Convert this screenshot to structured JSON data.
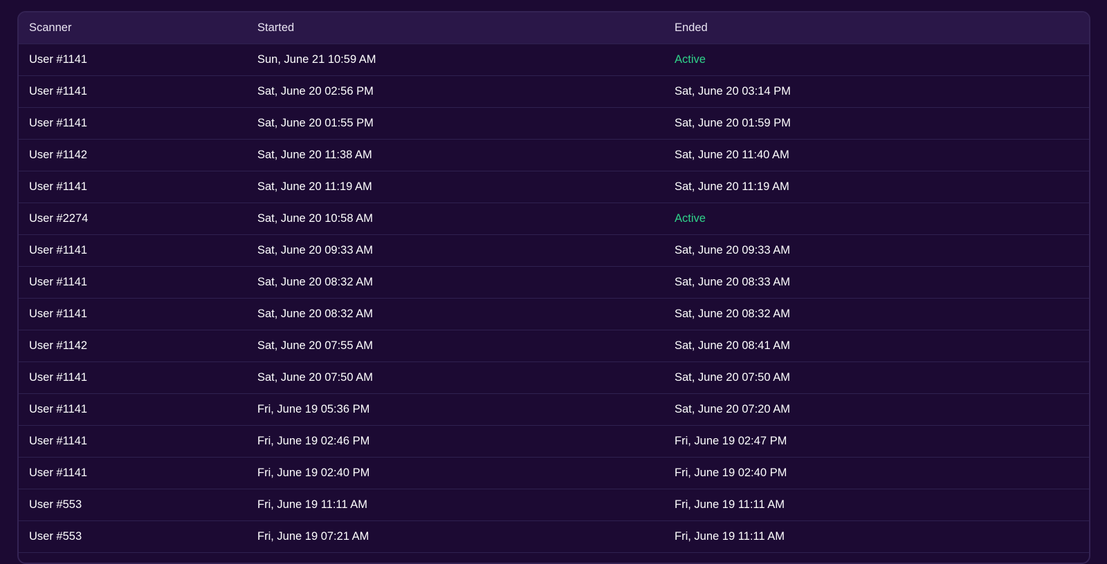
{
  "table": {
    "columns": [
      "Scanner",
      "Started",
      "Ended"
    ],
    "active_color": "#2fd38a",
    "rows": [
      {
        "scanner": "User #1141",
        "started": "Sun, June 21 10:59 AM",
        "ended": "Active",
        "active": true
      },
      {
        "scanner": "User #1141",
        "started": "Sat, June 20 02:56 PM",
        "ended": "Sat, June 20 03:14 PM",
        "active": false
      },
      {
        "scanner": "User #1141",
        "started": "Sat, June 20 01:55 PM",
        "ended": "Sat, June 20 01:59 PM",
        "active": false
      },
      {
        "scanner": "User #1142",
        "started": "Sat, June 20 11:38 AM",
        "ended": "Sat, June 20 11:40 AM",
        "active": false
      },
      {
        "scanner": "User #1141",
        "started": "Sat, June 20 11:19 AM",
        "ended": "Sat, June 20 11:19 AM",
        "active": false
      },
      {
        "scanner": "User #2274",
        "started": "Sat, June 20 10:58 AM",
        "ended": "Active",
        "active": true
      },
      {
        "scanner": "User #1141",
        "started": "Sat, June 20 09:33 AM",
        "ended": "Sat, June 20 09:33 AM",
        "active": false
      },
      {
        "scanner": "User #1141",
        "started": "Sat, June 20 08:32 AM",
        "ended": "Sat, June 20 08:33 AM",
        "active": false
      },
      {
        "scanner": "User #1141",
        "started": "Sat, June 20 08:32 AM",
        "ended": "Sat, June 20 08:32 AM",
        "active": false
      },
      {
        "scanner": "User #1142",
        "started": "Sat, June 20 07:55 AM",
        "ended": "Sat, June 20 08:41 AM",
        "active": false
      },
      {
        "scanner": "User #1141",
        "started": "Sat, June 20 07:50 AM",
        "ended": "Sat, June 20 07:50 AM",
        "active": false
      },
      {
        "scanner": "User #1141",
        "started": "Fri, June 19 05:36 PM",
        "ended": "Sat, June 20 07:20 AM",
        "active": false
      },
      {
        "scanner": "User #1141",
        "started": "Fri, June 19 02:46 PM",
        "ended": "Fri, June 19 02:47 PM",
        "active": false
      },
      {
        "scanner": "User #1141",
        "started": "Fri, June 19 02:40 PM",
        "ended": "Fri, June 19 02:40 PM",
        "active": false
      },
      {
        "scanner": "User #553",
        "started": "Fri, June 19 11:11 AM",
        "ended": "Fri, June 19 11:11 AM",
        "active": false
      },
      {
        "scanner": "User #553",
        "started": "Fri, June 19 07:21 AM",
        "ended": "Fri, June 19 11:11 AM",
        "active": false
      }
    ]
  }
}
